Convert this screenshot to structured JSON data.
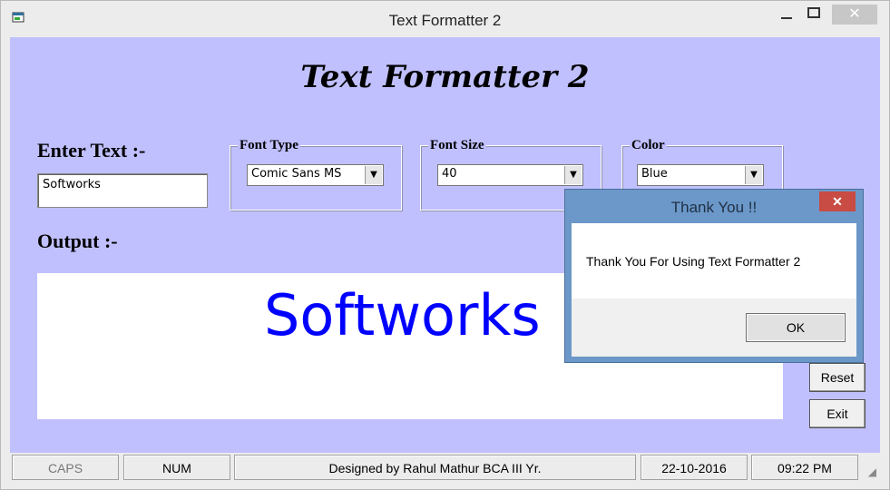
{
  "window": {
    "title": "Text Formatter 2",
    "min_glyph": "—",
    "max_glyph": "☐",
    "close_glyph": "✕"
  },
  "form": {
    "heading": "Text Formatter 2",
    "enter_text_label": "Enter Text :-",
    "text_value": "Softworks",
    "output_label": "Output :-",
    "output_text": "Softworks",
    "output_color": "#0000ff",
    "font_type": {
      "title": "Font Type",
      "value": "Comic Sans MS"
    },
    "font_size": {
      "title": "Font Size",
      "value": "40"
    },
    "color": {
      "title": "Color",
      "value": "Blue"
    },
    "buttons": {
      "reset": "Reset",
      "exit": "Exit"
    }
  },
  "statusbar": {
    "caps": "CAPS",
    "num": "NUM",
    "designer": "Designed by Rahul Mathur BCA III Yr.",
    "date": "22-10-2016",
    "time": "09:22 PM"
  },
  "dialog": {
    "title": "Thank You !!",
    "message": "Thank You For Using Text Formatter 2",
    "ok_label": "OK",
    "close_glyph": "✕"
  },
  "colors": {
    "client_bg": "#c0c0ff",
    "dialog_frame": "#6b98c8",
    "close_red": "#c84b44"
  }
}
